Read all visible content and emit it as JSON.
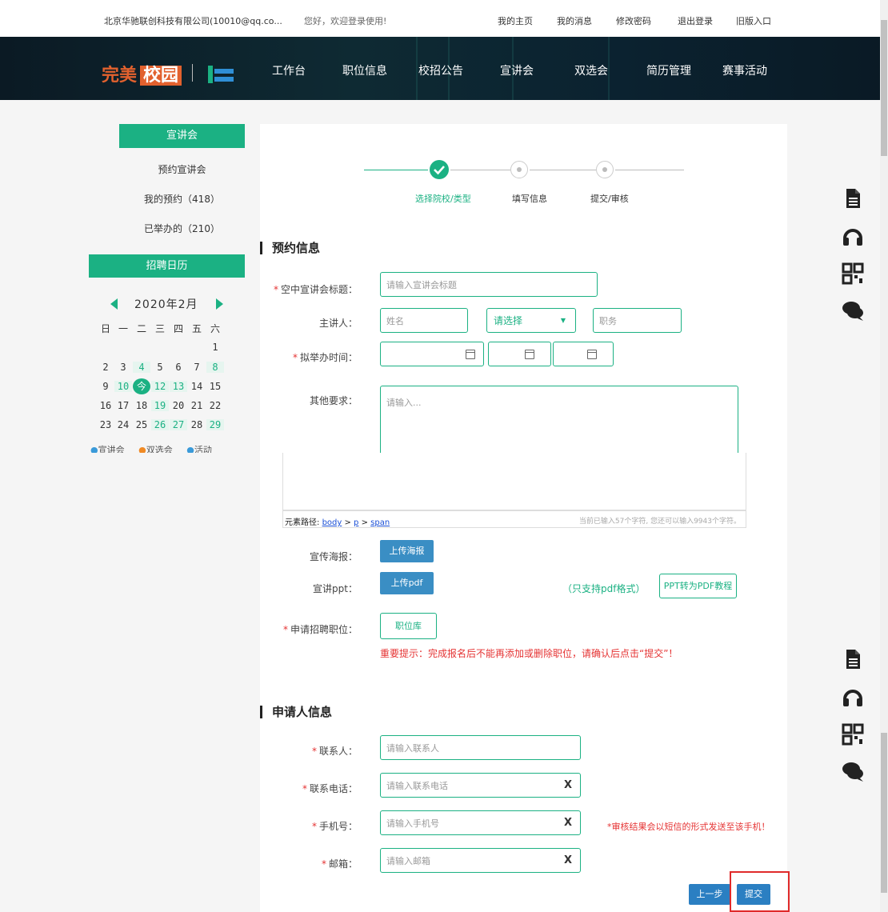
{
  "topbar": {
    "company": "北京华驰联创科技有限公司(10010@qq.co...",
    "welcome": "您好，欢迎登录使用!",
    "links": [
      "我的主页",
      "我的消息",
      "修改密码",
      "退出登录",
      "旧版入口"
    ]
  },
  "logo": {
    "text_a": "完美",
    "text_b": "校园"
  },
  "nav": [
    "工作台",
    "职位信息",
    "校招公告",
    "宣讲会",
    "双选会",
    "简历管理",
    "赛事活动"
  ],
  "sidebar": {
    "head": "宣讲会",
    "items": [
      "预约宣讲会",
      "我的预约（418）",
      "已举办的（210）"
    ],
    "calendar_head": "招聘日历",
    "month": "2020年2月",
    "weekdays": [
      "日",
      "一",
      "二",
      "三",
      "四",
      "五",
      "六"
    ],
    "today_label": "今",
    "legend": [
      "宣讲会",
      "双选会",
      "活动"
    ]
  },
  "steps": [
    "选择院校/类型",
    "填写信息",
    "提交/审核"
  ],
  "section1": {
    "title": "预约信息",
    "title_label": "空中宣讲会标题：",
    "title_ph": "请输入宣讲会标题",
    "speaker_label": "主讲人：",
    "speaker_name_ph": "姓名",
    "speaker_select": "请选择",
    "speaker_job_ph": "职务",
    "time_label": "拟举办时间：",
    "other_label": "其他要求：",
    "other_ph": "请输入..."
  },
  "editor": {
    "path_label": "元素路径:",
    "path": [
      "body",
      "p",
      "span"
    ],
    "counter": "当前已输入57个字符, 您还可以输入9943个字符。"
  },
  "upload": {
    "poster_label": "宣传海报：",
    "poster_btn": "上传海报",
    "ppt_label": "宣讲ppt：",
    "ppt_btn": "上传pdf",
    "ppt_note": "（只支持pdf格式）",
    "ppt_tutorial": "PPT转为PDF教程",
    "position_label": "申请招聘职位：",
    "position_btn": "职位库",
    "position_warning": "重要提示：完成报名后不能再添加或删除职位，请确认后点击“提交”！"
  },
  "section2": {
    "title": "申请人信息",
    "contact_label": "联系人：",
    "contact_ph": "请输入联系人",
    "phone_label": "联系电话：",
    "phone_ph": "请输入联系电话",
    "mobile_label": "手机号：",
    "mobile_ph": "请输入手机号",
    "mobile_note": "*审核结果会以短信的形式发送至该手机！",
    "email_label": "邮箱：",
    "email_ph": "请输入邮箱",
    "clear_x": "X"
  },
  "actions": {
    "prev": "上一步",
    "submit": "提交"
  },
  "colors": {
    "accent": "#1bb183",
    "blue": "#3a8ec4",
    "danger": "#e53333"
  }
}
